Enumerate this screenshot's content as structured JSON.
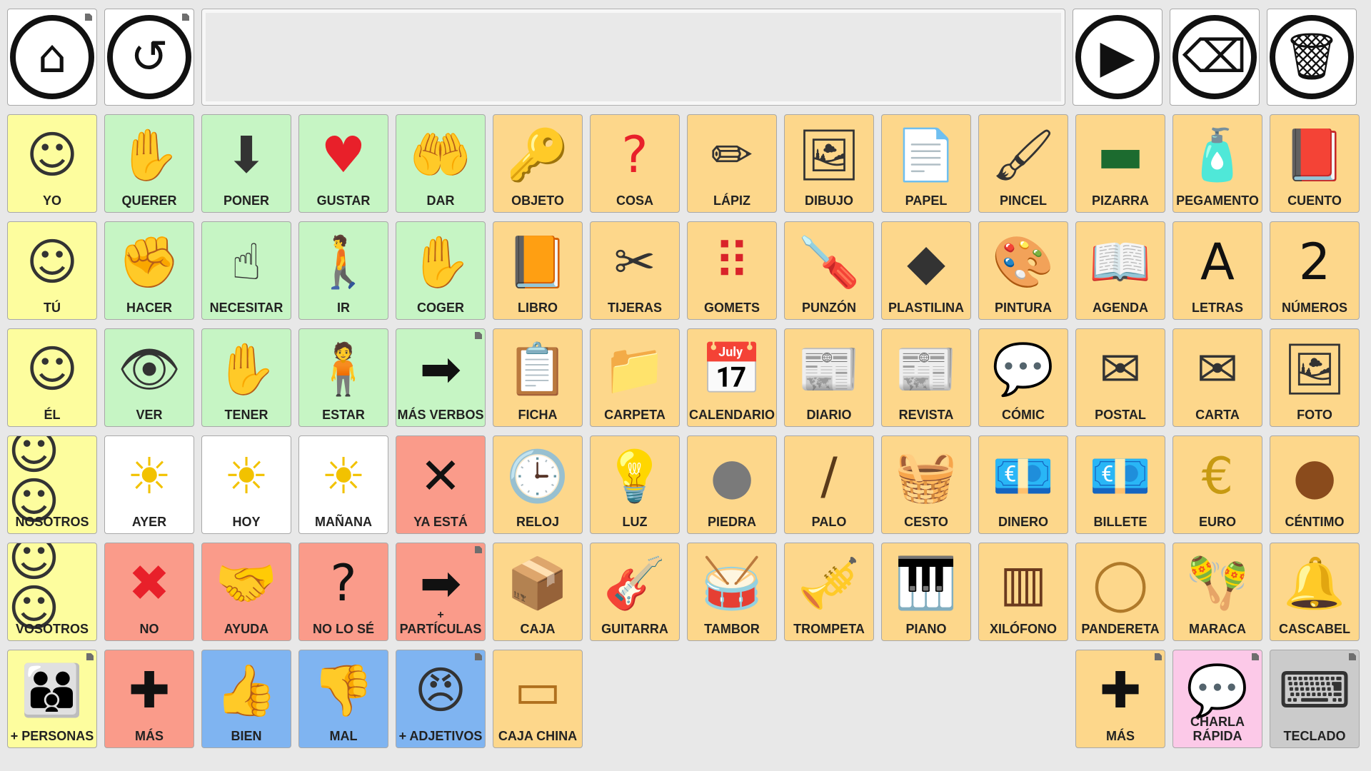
{
  "colors": {
    "person": "#fdfd9e",
    "verb": "#c6f5c4",
    "noun": "#fdd78b",
    "time": "#ffffff",
    "social": "#fa9b8a",
    "adjective": "#7fb4f1",
    "talk": "#fcc9e8",
    "keyboard": "#cbcbcb"
  },
  "toolbar": {
    "home": {
      "icon": "home-icon",
      "glyph": "⌂"
    },
    "undo": {
      "icon": "undo-icon",
      "glyph": "↺"
    },
    "message_text": "",
    "speak": {
      "icon": "play-icon",
      "glyph": "▶"
    },
    "backspace": {
      "icon": "backspace-icon",
      "glyph": "⌫"
    },
    "clear": {
      "icon": "trash-icon",
      "glyph": "🗑"
    }
  },
  "grid": [
    [
      {
        "label": "YO",
        "icon": "person-self-icon",
        "glyph": "☺",
        "color": "person"
      },
      {
        "label": "QUERER",
        "icon": "want-hand-icon",
        "glyph": "✋",
        "color": "verb"
      },
      {
        "label": "PONER",
        "icon": "put-icon",
        "glyph": "⬇",
        "color": "verb"
      },
      {
        "label": "GUSTAR",
        "icon": "like-heart-icon",
        "glyph": "♥",
        "color": "verb"
      },
      {
        "label": "DAR",
        "icon": "give-icon",
        "glyph": "🤲",
        "color": "verb"
      },
      {
        "label": "OBJETO",
        "icon": "objects-icon",
        "glyph": "🔑",
        "color": "noun"
      },
      {
        "label": "COSA",
        "icon": "thing-icon",
        "glyph": "?",
        "color": "noun"
      },
      {
        "label": "LÁPIZ",
        "icon": "pencil-icon",
        "glyph": "✏",
        "color": "noun"
      },
      {
        "label": "DIBUJO",
        "icon": "drawing-icon",
        "glyph": "🖼",
        "color": "noun"
      },
      {
        "label": "PAPEL",
        "icon": "paper-icon",
        "glyph": "📄",
        "color": "noun"
      },
      {
        "label": "PINCEL",
        "icon": "brush-icon",
        "glyph": "🖌",
        "color": "noun"
      },
      {
        "label": "PIZARRA",
        "icon": "blackboard-icon",
        "glyph": "▬",
        "color": "noun"
      },
      {
        "label": "PEGAMENTO",
        "icon": "glue-icon",
        "glyph": "🧴",
        "color": "noun"
      },
      {
        "label": "CUENTO",
        "icon": "storybook-icon",
        "glyph": "📕",
        "color": "noun"
      }
    ],
    [
      {
        "label": "TÚ",
        "icon": "person-you-icon",
        "glyph": "☺",
        "color": "person"
      },
      {
        "label": "HACER",
        "icon": "do-icon",
        "glyph": "✊",
        "color": "verb"
      },
      {
        "label": "NECESITAR",
        "icon": "need-icon",
        "glyph": "☝",
        "color": "verb"
      },
      {
        "label": "IR",
        "icon": "go-icon",
        "glyph": "🚶",
        "color": "verb"
      },
      {
        "label": "COGER",
        "icon": "take-icon",
        "glyph": "✋",
        "color": "verb"
      },
      {
        "label": "LIBRO",
        "icon": "book-icon",
        "glyph": "📙",
        "color": "noun"
      },
      {
        "label": "TIJERAS",
        "icon": "scissors-icon",
        "glyph": "✂",
        "color": "noun"
      },
      {
        "label": "GOMETS",
        "icon": "stickers-icon",
        "glyph": "⠿",
        "color": "noun"
      },
      {
        "label": "PUNZÓN",
        "icon": "awl-icon",
        "glyph": "🪛",
        "color": "noun"
      },
      {
        "label": "PLASTILINA",
        "icon": "plasticine-icon",
        "glyph": "◆",
        "color": "noun"
      },
      {
        "label": "PINTURA",
        "icon": "paint-icon",
        "glyph": "🎨",
        "color": "noun"
      },
      {
        "label": "AGENDA",
        "icon": "agenda-icon",
        "glyph": "📖",
        "color": "noun"
      },
      {
        "label": "LETRAS",
        "icon": "letters-icon",
        "glyph": "A",
        "color": "noun"
      },
      {
        "label": "NÚMEROS",
        "icon": "numbers-icon",
        "glyph": "2",
        "color": "noun"
      }
    ],
    [
      {
        "label": "ÉL",
        "icon": "person-he-icon",
        "glyph": "☺",
        "color": "person"
      },
      {
        "label": "VER",
        "icon": "see-icon",
        "glyph": "👁",
        "color": "verb"
      },
      {
        "label": "TENER",
        "icon": "have-icon",
        "glyph": "✋",
        "color": "verb"
      },
      {
        "label": "ESTAR",
        "icon": "be-icon",
        "glyph": "🧍",
        "color": "verb"
      },
      {
        "label": "MÁS VERBOS",
        "icon": "arrow-right-icon",
        "glyph": "➡",
        "color": "verb",
        "folder": true
      },
      {
        "label": "FICHA",
        "icon": "form-icon",
        "glyph": "📋",
        "color": "noun"
      },
      {
        "label": "CARPETA",
        "icon": "folder-icon",
        "glyph": "📁",
        "color": "noun"
      },
      {
        "label": "CALENDARIO",
        "icon": "calendar-icon",
        "glyph": "📅",
        "color": "noun"
      },
      {
        "label": "DIARIO",
        "icon": "newspaper-icon",
        "glyph": "📰",
        "color": "noun"
      },
      {
        "label": "REVISTA",
        "icon": "magazine-icon",
        "glyph": "📰",
        "color": "noun"
      },
      {
        "label": "CÓMIC",
        "icon": "comic-icon",
        "glyph": "💬",
        "color": "noun"
      },
      {
        "label": "POSTAL",
        "icon": "postcard-icon",
        "glyph": "✉",
        "color": "noun"
      },
      {
        "label": "CARTA",
        "icon": "letter-icon",
        "glyph": "✉",
        "color": "noun"
      },
      {
        "label": "FOTO",
        "icon": "photo-icon",
        "glyph": "🖼",
        "color": "noun"
      }
    ],
    [
      {
        "label": "NOSOTROS",
        "icon": "person-we-icon",
        "glyph": "☺☺",
        "color": "person"
      },
      {
        "label": "AYER",
        "icon": "yesterday-icon",
        "glyph": "☀",
        "color": "time"
      },
      {
        "label": "HOY",
        "icon": "today-icon",
        "glyph": "☀",
        "color": "time"
      },
      {
        "label": "MAÑANA",
        "icon": "tomorrow-icon",
        "glyph": "☀",
        "color": "time"
      },
      {
        "label": "YA ESTÁ",
        "icon": "finished-icon",
        "glyph": "✕",
        "color": "social"
      },
      {
        "label": "RELOJ",
        "icon": "clock-icon",
        "glyph": "🕒",
        "color": "noun"
      },
      {
        "label": "LUZ",
        "icon": "lightbulb-icon",
        "glyph": "💡",
        "color": "noun"
      },
      {
        "label": "PIEDRA",
        "icon": "stone-icon",
        "glyph": "●",
        "color": "noun"
      },
      {
        "label": "PALO",
        "icon": "stick-icon",
        "glyph": "/",
        "color": "noun"
      },
      {
        "label": "CESTO",
        "icon": "basket-icon",
        "glyph": "🧺",
        "color": "noun"
      },
      {
        "label": "DINERO",
        "icon": "money-icon",
        "glyph": "💶",
        "color": "noun"
      },
      {
        "label": "BILLETE",
        "icon": "banknote-icon",
        "glyph": "💶",
        "color": "noun"
      },
      {
        "label": "EURO",
        "icon": "euro-coin-icon",
        "glyph": "€",
        "color": "noun"
      },
      {
        "label": "CÉNTIMO",
        "icon": "cent-coin-icon",
        "glyph": "●",
        "color": "noun"
      }
    ],
    [
      {
        "label": "VOSOTROS",
        "icon": "person-you-plural-icon",
        "glyph": "☺☺",
        "color": "person"
      },
      {
        "label": "NO",
        "icon": "no-cross-icon",
        "glyph": "✖",
        "color": "social"
      },
      {
        "label": "AYUDA",
        "icon": "help-icon",
        "glyph": "🤝",
        "color": "social"
      },
      {
        "label": "NO LO SÉ",
        "icon": "dont-know-icon",
        "glyph": "?",
        "color": "social"
      },
      {
        "label": "PARTÍCULAS",
        "icon": "particles-icon",
        "glyph": "➡",
        "color": "social",
        "folder": true,
        "sub": "+"
      },
      {
        "label": "CAJA",
        "icon": "box-icon",
        "glyph": "📦",
        "color": "noun"
      },
      {
        "label": "GUITARRA",
        "icon": "guitar-icon",
        "glyph": "🎸",
        "color": "noun"
      },
      {
        "label": "TAMBOR",
        "icon": "drum-icon",
        "glyph": "🥁",
        "color": "noun"
      },
      {
        "label": "TROMPETA",
        "icon": "trumpet-icon",
        "glyph": "🎺",
        "color": "noun"
      },
      {
        "label": "PIANO",
        "icon": "piano-icon",
        "glyph": "🎹",
        "color": "noun"
      },
      {
        "label": "XILÓFONO",
        "icon": "xylophone-icon",
        "glyph": "▥",
        "color": "noun"
      },
      {
        "label": "PANDERETA",
        "icon": "tambourine-icon",
        "glyph": "◯",
        "color": "noun"
      },
      {
        "label": "MARACA",
        "icon": "maraca-icon",
        "glyph": "🪇",
        "color": "noun"
      },
      {
        "label": "CASCABEL",
        "icon": "bell-icon",
        "glyph": "🔔",
        "color": "noun"
      }
    ],
    [
      {
        "label": "+ PERSONAS",
        "icon": "people-icon",
        "glyph": "👪",
        "color": "person",
        "folder": true
      },
      {
        "label": "MÁS",
        "icon": "plus-icon",
        "glyph": "✚",
        "color": "social"
      },
      {
        "label": "BIEN",
        "icon": "thumbs-up-icon",
        "glyph": "👍",
        "color": "adjective"
      },
      {
        "label": "MAL",
        "icon": "thumbs-down-icon",
        "glyph": "👎",
        "color": "adjective"
      },
      {
        "label": "+ ADJETIVOS",
        "icon": "faces-icon",
        "glyph": "😠",
        "color": "adjective",
        "folder": true
      },
      {
        "label": "CAJA CHINA",
        "icon": "wood-block-icon",
        "glyph": "▭",
        "color": "noun"
      },
      null,
      null,
      null,
      null,
      null,
      {
        "label": "MÁS",
        "icon": "plus-icon",
        "glyph": "✚",
        "color": "noun",
        "folder": true
      },
      {
        "label": "CHARLA RÁPIDA",
        "icon": "quick-chat-icon",
        "glyph": "💬",
        "color": "talk",
        "folder": true
      },
      {
        "label": "TECLADO",
        "icon": "keyboard-icon",
        "glyph": "⌨",
        "color": "keyboard",
        "folder": true
      }
    ]
  ]
}
